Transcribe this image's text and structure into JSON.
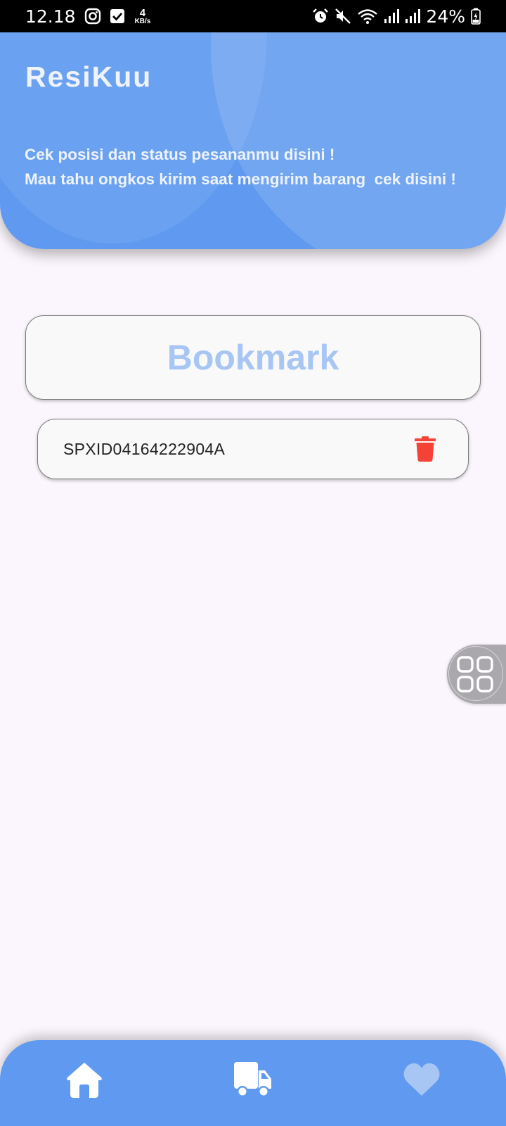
{
  "status_bar": {
    "time": "12.18",
    "net_speed_value": "4",
    "net_speed_unit": "KB/s",
    "battery": "24%",
    "icons": [
      "instagram-icon",
      "check-square-icon",
      "alarm-icon",
      "mute-icon",
      "wifi-icon",
      "signal-icon",
      "signal-icon",
      "battery-charging-icon"
    ]
  },
  "header": {
    "title": "ResiKuu",
    "desc_line1": "Cek posisi dan status pesananmu disini !",
    "desc_line2": "Mau tahu ongkos kirim saat mengirim barang  cek disini !"
  },
  "bookmark": {
    "title": "Bookmark",
    "items": [
      {
        "resi": "SPXID04164222904A",
        "action_icon": "trash-icon"
      }
    ]
  },
  "bottom_nav": {
    "items": [
      {
        "icon": "home-icon",
        "active": true
      },
      {
        "icon": "truck-icon",
        "active": true
      },
      {
        "icon": "heart-icon",
        "active": false
      }
    ]
  },
  "colors": {
    "primary": "#5f9af0",
    "bookmark_title": "#a7c6f4",
    "delete": "#f44336",
    "background": "#fbf6fd"
  }
}
